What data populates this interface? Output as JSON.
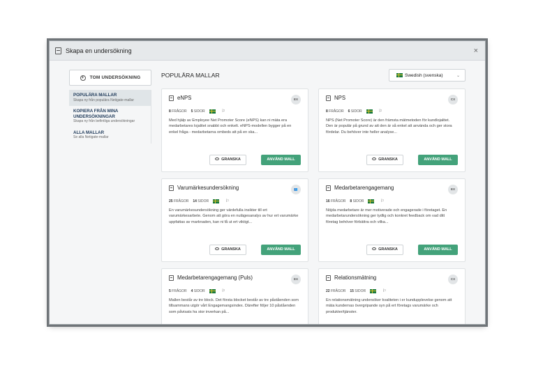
{
  "modal": {
    "title": "Skapa en undersökning",
    "close": "×"
  },
  "sidebar": {
    "blank_button": "TOM UNDERSÖKNING",
    "items": [
      {
        "title": "POPULÄRA MALLAR",
        "subtitle": "Skapa ny från populära Netigate-mallar",
        "active": true
      },
      {
        "title": "KOPIERA FRÅN MINA UNDERSÖKNINGAR",
        "subtitle": "Skapa ny från befintliga undersökningar",
        "active": false
      },
      {
        "title": "ALLA MALLAR",
        "subtitle": "Se alla Netigate-mallar",
        "active": false
      }
    ]
  },
  "main": {
    "title": "POPULÄRA MALLAR",
    "language": "Swedish (svenska)"
  },
  "buttons": {
    "review": "GRANSKA",
    "use": "ANVÄND MALL"
  },
  "cards": [
    {
      "title": "eNPS",
      "avatar": "EX",
      "questions": "8",
      "questions_label": "FRÅGOR",
      "pages": "5",
      "pages_label": "SIDOR",
      "description": "Med hjälp av Employee Net Promoter Score (eNPS) kan ni mäta era medarbetares lojalitet snabbt och enkelt. eNPS-modellen bygger på en enkel fråga - medarbetarna ombeds att på en ska..."
    },
    {
      "title": "NPS",
      "avatar": "CX",
      "questions": "8",
      "questions_label": "FRÅGOR",
      "pages": "6",
      "pages_label": "SIDOR",
      "description": "NPS (Net Promoter Score) är den främsta mätmetoden för kundlojalitet. Den är populär på grund av att den är så enkel att använda och ger stora fördelar. Du behöver inte heller analyse..."
    },
    {
      "title": "Varumärkesundersökning",
      "avatar": "👥",
      "questions": "25",
      "questions_label": "FRÅGOR",
      "pages": "14",
      "pages_label": "SIDOR",
      "description": "En varumärkesundersökning ger värdefulla insikter till ert varumärkesarbete. Genom att göra en nulägesanalys av hur ert varumärke uppfattas av marknaden, kan ni få ut ert viktigt..."
    },
    {
      "title": "Medarbetarengagemang",
      "avatar": "EX",
      "questions": "16",
      "questions_label": "FRÅGOR",
      "pages": "8",
      "pages_label": "SIDOR",
      "description": "Nöjda medarbetare är mer motiverade och engagerade i företaget. En medarbetarundersökning ger tydlig och konkret feedback om vad ditt företag behöver förbättra och vilka..."
    },
    {
      "title": "Medarbetarengagemang (Puls)",
      "avatar": "EX",
      "questions": "5",
      "questions_label": "FRÅGOR",
      "pages": "4",
      "pages_label": "SIDOR",
      "description": "Mallen består av tre block. Det första blocket består av tre påståenden som tillsammans utgör vårt Engagemangsindex. Därefter följer 10 påståenden som påvisats ha stor inverkan på..."
    },
    {
      "title": "Relationsmätning",
      "avatar": "CX",
      "questions": "22",
      "questions_label": "FRÅGOR",
      "pages": "15",
      "pages_label": "SIDOR",
      "description": "En relationsmätning undersöker kvaliteten i er kundupplevelse genom att mäta kundernas övergripande syn på ert företags varumärke och produkter/tjänster."
    }
  ]
}
